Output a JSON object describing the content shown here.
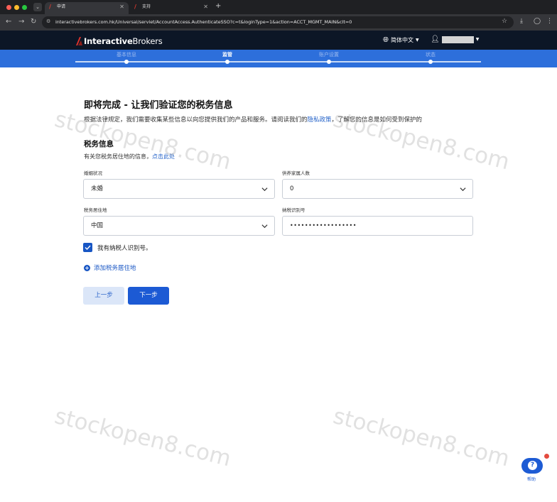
{
  "browser": {
    "tabs": [
      {
        "title": "申请",
        "active": true
      },
      {
        "title": "支持",
        "active": false
      }
    ],
    "url": "interactivebrokers.com.hk/Universal/servlet/AccountAccess.AuthenticateSSO?c=t&loginType=1&action=ACCT_MGMT_MAIN&clt=0"
  },
  "header": {
    "logo_bold": "Interactive",
    "logo_light": "Brokers",
    "language": "简体中文",
    "brand_color": "#e0322b"
  },
  "progress": {
    "steps": [
      {
        "label": "基本信息",
        "state": "done"
      },
      {
        "label": "监管",
        "state": "active"
      },
      {
        "label": "账户设置",
        "state": "todo"
      },
      {
        "label": "状态",
        "state": "todo"
      }
    ]
  },
  "main": {
    "title": "即将完成 - 让我们验证您的税务信息",
    "intro_before": "根据法律规定，我们需要收集某些信息以向您提供我们的产品和服务。请阅读我们的",
    "intro_link": "隐私政策",
    "intro_after": "，了解您的信息是如何受到保护的",
    "section_title": "税务信息",
    "section_sub_before": "有关您税务居住地的信息，",
    "section_sub_link": "点击此处",
    "fields": {
      "marital_label": "婚姻状况",
      "marital_value": "未婚",
      "dependents_label": "供养家属人数",
      "dependents_value": "0",
      "residence_label": "税务居住地",
      "residence_value": "中国",
      "tin_label": "纳税识别号",
      "tin_value": "••••••••••••••••••"
    },
    "checkbox_label": "我有纳税人识别号。",
    "checkbox_checked": true,
    "add_residence": "添加税务居住地",
    "prev_button": "上一步",
    "next_button": "下一步"
  },
  "watermark": "stockopen8.com",
  "help": {
    "icon": "?",
    "label": "帮助"
  },
  "colors": {
    "header_bg": "#0c1626",
    "progress_bg": "#2d6fdb",
    "primary": "#1c5ad4",
    "link": "#2563c9"
  }
}
